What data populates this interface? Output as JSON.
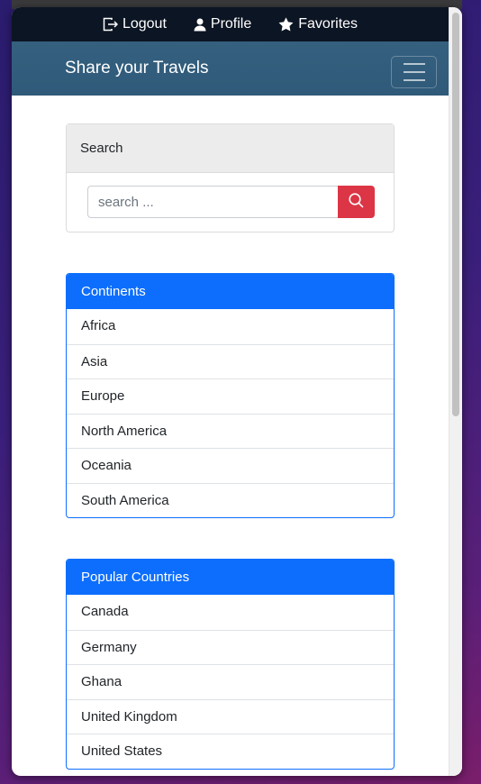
{
  "nav": {
    "logout_label": "Logout",
    "profile_label": "Profile",
    "favorites_label": "Favorites"
  },
  "brand": {
    "title": "Share your Travels"
  },
  "search": {
    "header": "Search",
    "placeholder": "search ..."
  },
  "continents": {
    "header": "Continents",
    "items": [
      "Africa",
      "Asia",
      "Europe",
      "North America",
      "Oceania",
      "South America"
    ]
  },
  "countries": {
    "header": "Popular Countries",
    "items": [
      "Canada",
      "Germany",
      "Ghana",
      "United Kingdom",
      "United States"
    ]
  },
  "colors": {
    "primary": "#0d6efd",
    "danger": "#dc3545",
    "navbar": "#0c1523",
    "brandbar": "#33607f"
  }
}
